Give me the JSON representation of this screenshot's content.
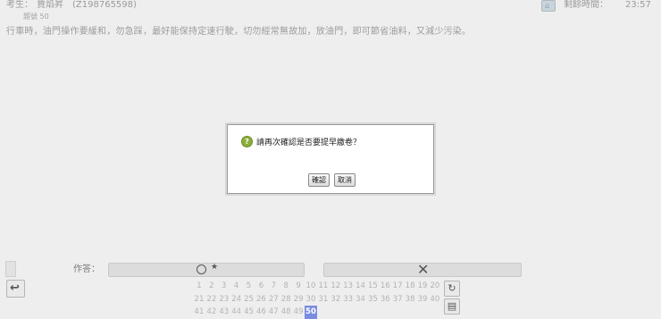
{
  "header": {
    "examinee_label": "考生：",
    "examinee_name": "賈焰昇",
    "examinee_id": "(Z198765598)",
    "remaining_label": "剩餘時間：",
    "remaining_time": "23:57"
  },
  "question": {
    "number_label": "題號 50",
    "text": "行車時，油門操作要緩和，勿急踩，最好能保持定速行駛，切勿經常無故加，放油門，即可節省油料，又減少污染。"
  },
  "dialog": {
    "message": "請再次確認是否要提早繳卷？",
    "confirm_label": "確認",
    "cancel_label": "取消"
  },
  "answer": {
    "label": "作答：",
    "option_true_mark": "○",
    "option_true_star": "★",
    "option_false_mark": "✕"
  },
  "question_grid": {
    "rows": [
      [
        "1",
        "2",
        "3",
        "4",
        "5",
        "6",
        "7",
        "8",
        "9",
        "10",
        "11",
        "12",
        "13",
        "14",
        "15",
        "16",
        "17",
        "18",
        "19",
        "20"
      ],
      [
        "21",
        "22",
        "23",
        "24",
        "25",
        "26",
        "27",
        "28",
        "29",
        "30",
        "31",
        "32",
        "33",
        "34",
        "35",
        "36",
        "37",
        "38",
        "39",
        "40"
      ],
      [
        "41",
        "42",
        "43",
        "44",
        "45",
        "46",
        "47",
        "48",
        "49",
        "50"
      ]
    ],
    "current": "50"
  }
}
